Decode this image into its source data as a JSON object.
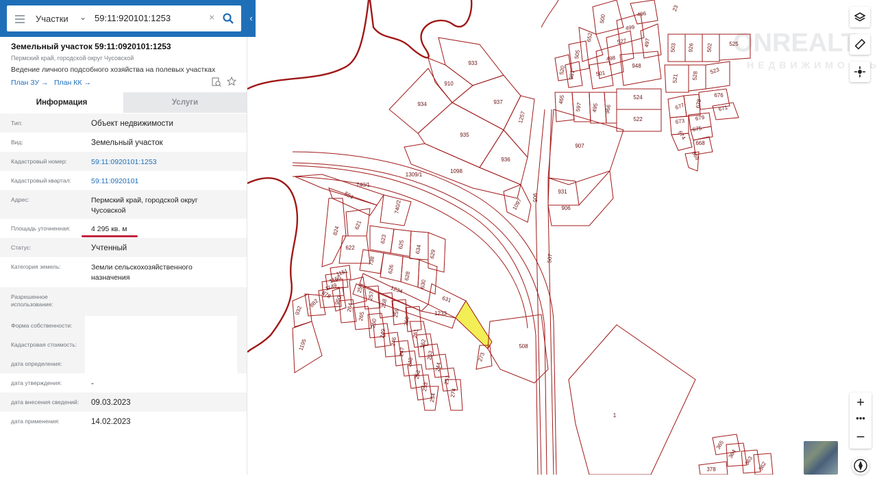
{
  "search": {
    "layer": "Участки",
    "query": "59:11:920101:1253",
    "clear_symbol": "×",
    "icons": {
      "menu": "hamburger-icon",
      "dropdown": "chevron-down-icon",
      "search": "search-icon",
      "collapse": "chevron-left-icon"
    }
  },
  "object": {
    "title": "Земельный участок 59:11:0920101:1253",
    "region": "Пермский край, городской округ Чусовской",
    "purpose": "Ведение личного подсобного хозяйства на полевых участках",
    "plan_zu": "План ЗУ →",
    "plan_kk": "План КК →"
  },
  "tabs": {
    "info": "Информация",
    "services": "Услуги"
  },
  "info": [
    {
      "key": "Тип:",
      "value": "Объект недвижимости"
    },
    {
      "key": "Вид:",
      "value": "Земельный участок"
    },
    {
      "key": "Кадастровый номер:",
      "value": "59:11:0920101:1253"
    },
    {
      "key": "Кадастровый квартал:",
      "value": "59:11:0920101"
    },
    {
      "key": "Адрес:",
      "value": "Пермский край, городской округ Чусовской"
    },
    {
      "key": "Площадь уточненная:",
      "value": "4 295 кв. м"
    },
    {
      "key": "Статус:",
      "value": "Учтенный"
    },
    {
      "key": "Категория земель:",
      "value": "Земли сельскохозяйственного назначения"
    },
    {
      "key": "Разрешенное использование:",
      "value": ""
    },
    {
      "key": "Форма собственности:",
      "value": ""
    },
    {
      "key": "Кадастровая стоимость:",
      "value": ""
    },
    {
      "key": "дата определения:",
      "value": ""
    },
    {
      "key": "дата утверждения:",
      "value": "-"
    },
    {
      "key": "дата внесения сведений:",
      "value": "09.03.2023"
    },
    {
      "key": "дата применения:",
      "value": "14.02.2023"
    }
  ],
  "map": {
    "watermark_top": "ONREALT",
    "watermark_sub": "НЕДВИЖИМОСТЬ",
    "selected_plot": "1253",
    "plot_labels": [
      "933",
      "910",
      "934",
      "937",
      "1257",
      "935",
      "936",
      "1098",
      "1309/1",
      "1097",
      "905",
      "931",
      "906",
      "907",
      "507",
      "508",
      "1",
      "740/1",
      "554",
      "740/2",
      "824",
      "621",
      "622",
      "623",
      "625",
      "634",
      "629",
      "738",
      "626",
      "628",
      "630",
      "631",
      "1233",
      "1234",
      "1151",
      "1150",
      "1149",
      "878",
      "882",
      "932",
      "950",
      "256",
      "257",
      "258",
      "259",
      "260",
      "261",
      "262",
      "263",
      "244",
      "251",
      "274",
      "264",
      "265",
      "250",
      "249",
      "246",
      "247",
      "248",
      "252",
      "253",
      "254",
      "273",
      "1195",
      "496",
      "500",
      "652",
      "499",
      "527",
      "497",
      "505",
      "498",
      "948",
      "520",
      "981",
      "501",
      "503",
      "926",
      "502",
      "525",
      "521",
      "528",
      "523",
      "465",
      "597",
      "495",
      "966",
      "524",
      "522",
      "677",
      "678",
      "676",
      "673",
      "679",
      "671",
      "674",
      "675",
      "668",
      "669",
      "365",
      "364",
      "363",
      "362",
      "378",
      "23"
    ],
    "controls": {
      "layers": "layers-icon",
      "ruler": "ruler-icon",
      "locate": "crosshair-icon",
      "zoom_in": "+",
      "more": "•••",
      "zoom_out": "−",
      "compass": "compass-icon"
    },
    "colors": {
      "boundary": "#a01818",
      "selected_fill": "#f3ee55",
      "header": "#1f6fb8",
      "underline": "#c2243e"
    }
  }
}
